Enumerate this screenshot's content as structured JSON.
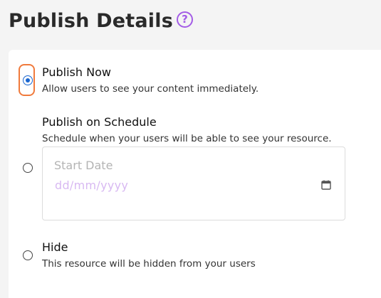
{
  "header": {
    "title": "Publish Details",
    "help_icon": "?"
  },
  "options": [
    {
      "label": "Publish Now",
      "description": "Allow users to see your content immediately.",
      "selected": true
    },
    {
      "label": "Publish on Schedule",
      "description": "Schedule when your users will be able to see your resource.",
      "selected": false,
      "date_field": {
        "label": "Start Date",
        "placeholder": "dd/mm/yyyy",
        "icon": "calendar-icon"
      }
    },
    {
      "label": "Hide",
      "description": "This resource will be hidden from your users",
      "selected": false
    }
  ],
  "colors": {
    "accent_purple": "#a35ce6",
    "radio_selected": "#1a66d0",
    "focus_ring": "#f07a3c",
    "placeholder": "#d8b9f2"
  }
}
